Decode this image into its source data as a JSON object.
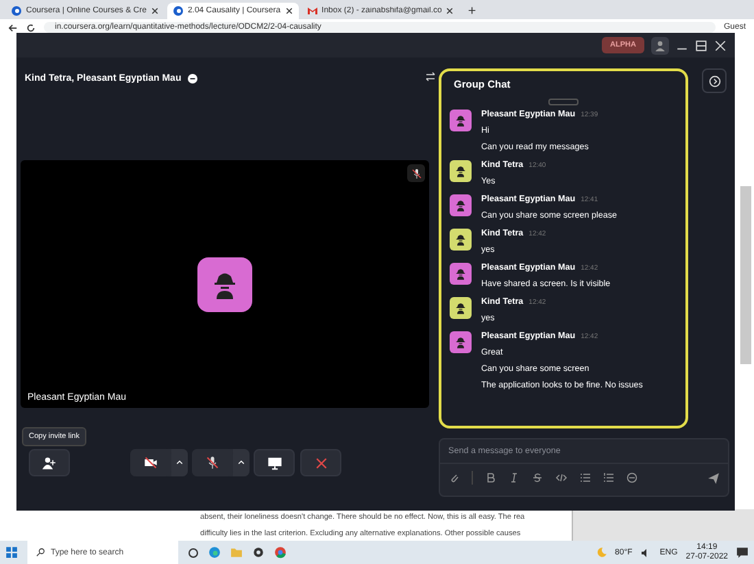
{
  "browser": {
    "tabs": [
      {
        "title": "Coursera | Online Courses & Cre",
        "selected": false
      },
      {
        "title": "2.04 Causality | Coursera",
        "selected": true
      },
      {
        "title": "Inbox (2) - zainabshifa@gmail.co",
        "selected": false
      }
    ],
    "new_tab": "+",
    "address": "in.coursera.org/learn/quantitative-methods/lecture/ODCM2/2-04-causality",
    "profile": "Guest"
  },
  "page": {
    "lines": [
      "absent, their loneliness doesn't change. There should be no effect. Now, this is all easy. The rea",
      "difficulty lies in the last criterion. Excluding any alternative explanations. Other possible causes"
    ]
  },
  "call_window": {
    "badge": "ALPHA",
    "participants_title": "Kind Tetra, Pleasant Egyptian Mau",
    "video_tile": {
      "name": "Pleasant Egyptian Mau",
      "color": "#d86bd2"
    },
    "tooltip": "Copy invite link",
    "camera_on": false,
    "mic_on": false
  },
  "chat": {
    "title": "Group Chat",
    "messages": [
      {
        "sender": "Pleasant Egyptian Mau",
        "time": "12:39",
        "color": "#d86bd2",
        "lines": [
          "Hi",
          "Can you read my messages"
        ]
      },
      {
        "sender": "Kind Tetra",
        "time": "12:40",
        "color": "#d3db6e",
        "lines": [
          "Yes"
        ]
      },
      {
        "sender": "Pleasant Egyptian Mau",
        "time": "12:41",
        "color": "#d86bd2",
        "lines": [
          "Can you share some screen please"
        ]
      },
      {
        "sender": "Kind Tetra",
        "time": "12:42",
        "color": "#d3db6e",
        "lines": [
          "yes"
        ]
      },
      {
        "sender": "Pleasant Egyptian Mau",
        "time": "12:42",
        "color": "#d86bd2",
        "lines": [
          "Have shared a screen. Is it visible"
        ]
      },
      {
        "sender": "Kind Tetra",
        "time": "12:42",
        "color": "#d3db6e",
        "lines": [
          "yes"
        ]
      },
      {
        "sender": "Pleasant Egyptian Mau",
        "time": "12:42",
        "color": "#d86bd2",
        "lines": [
          "Great",
          "Can you share some screen",
          "The application looks to be fine. No issues"
        ]
      }
    ],
    "placeholder": "Send a message to everyone"
  },
  "taskbar": {
    "search_placeholder": "Type here to search",
    "weather": "80°F",
    "language": "ENG",
    "time": "14:19",
    "date": "27-07-2022"
  }
}
